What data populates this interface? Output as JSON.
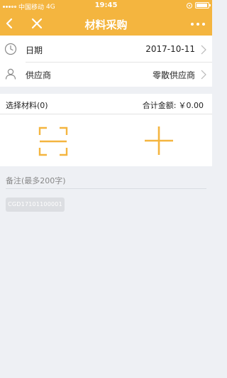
{
  "status_bar": {
    "carrier": "中国移动",
    "network": "4G",
    "time": "19:45"
  },
  "nav": {
    "title": "材料采购",
    "back_icon": "chevron-left-icon",
    "close_icon": "close-icon",
    "more_icon": "more-dots-icon"
  },
  "form": {
    "date": {
      "label": "日期",
      "value": "2017-10-11",
      "icon": "clock-icon"
    },
    "supplier": {
      "label": "供应商",
      "value": "零散供应商",
      "icon": "person-icon"
    }
  },
  "selection": {
    "label": "选择材料(0)",
    "total_label": "合计金额:",
    "total_value": "￥0.00"
  },
  "actions": {
    "scan_icon": "scan-icon",
    "add_icon": "plus-icon"
  },
  "remark": {
    "placeholder": "备注(最多200字)"
  },
  "order_code": "CGD17101100001",
  "colors": {
    "primary": "#f4b53f",
    "background": "#eef0f4"
  }
}
